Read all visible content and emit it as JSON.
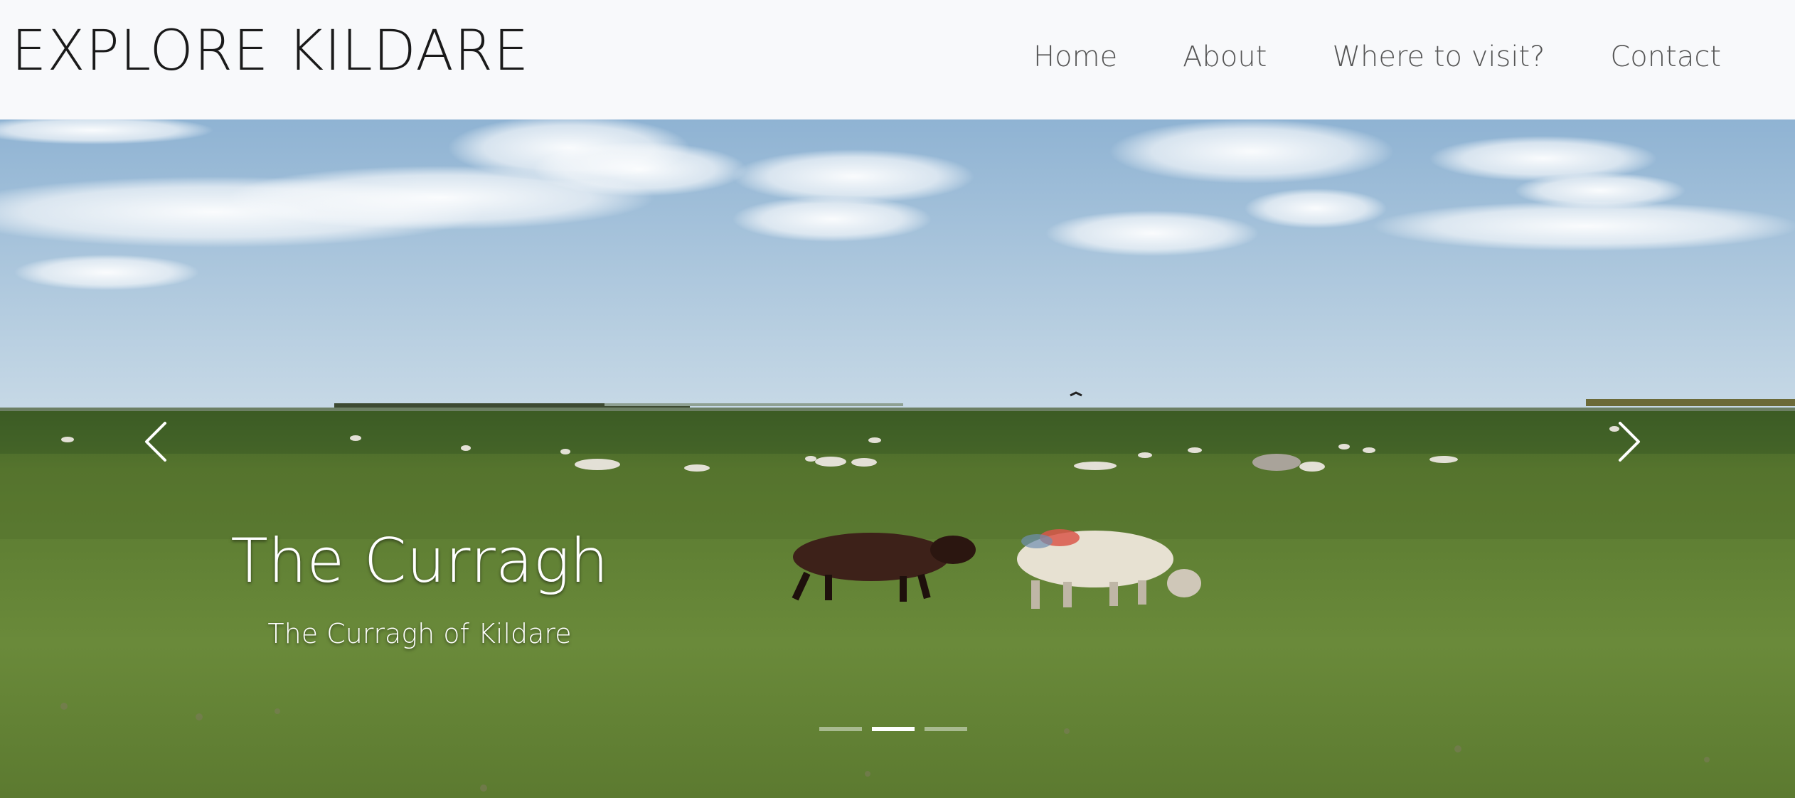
{
  "header": {
    "brand": "EXPLORE KILDARE",
    "nav": [
      {
        "label": "Home"
      },
      {
        "label": "About"
      },
      {
        "label": "Where to visit?"
      },
      {
        "label": "Contact"
      }
    ]
  },
  "carousel": {
    "active_slide": 2,
    "slide_count": 3,
    "caption": {
      "title": "The Curragh",
      "subtitle": "The Curragh of Kildare"
    },
    "prev_icon": "chevron-left-icon",
    "next_icon": "chevron-right-icon",
    "image": "photo of grassland with grazing sheep under a blue sky"
  },
  "colors": {
    "navbar_bg": "#f8f9fb",
    "brand_text": "#1a1a1a",
    "nav_text": "#555555",
    "sky_top": "#8fb3d3",
    "sky_bottom": "#c7d9e6",
    "grass": "#5b7a2f"
  }
}
